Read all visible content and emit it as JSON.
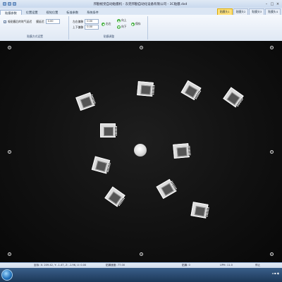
{
  "window": {
    "title": "邦勤视觉自动贴膜机 - 东莞邦勤自动化设备有限公司 - 3C贴膜.dxd"
  },
  "ribbon": {
    "tabs": [
      "贴膜参数",
      "位置设置",
      "视觉位置",
      "标准参数",
      "系统条件"
    ],
    "right_tabs": [
      "贴膜头1",
      "贴膜头2",
      "贴膜头3",
      "贴膜头4"
    ],
    "group1": {
      "label": "贴膜方式设置",
      "checkbox_label": "吸贴膜后的吹气延迟",
      "input_label": "膜延迟",
      "input_value": "0.00"
    },
    "group2": {
      "label": "贴膜调整",
      "row1_label": "左右偏移",
      "row1_value": "0.00",
      "row2_label": "上下偏移",
      "row2_value": "0.00",
      "btn_left": "右左",
      "btn_up": "向上",
      "btn_down": "向下",
      "btn_confirm": "保存"
    }
  },
  "status": {
    "coords": "坐标: X: 209.42, Y: -1.47, Z: -1.96, U: 0.00",
    "speed": "贴膜速度: 77.00",
    "count": "贴膜: 0",
    "uph": "UPH: 11.0",
    "state": "停止"
  },
  "colors": {
    "ribbon": "#dfe8f4",
    "canvas": "#111111",
    "active_tab": "#ffe07a"
  }
}
